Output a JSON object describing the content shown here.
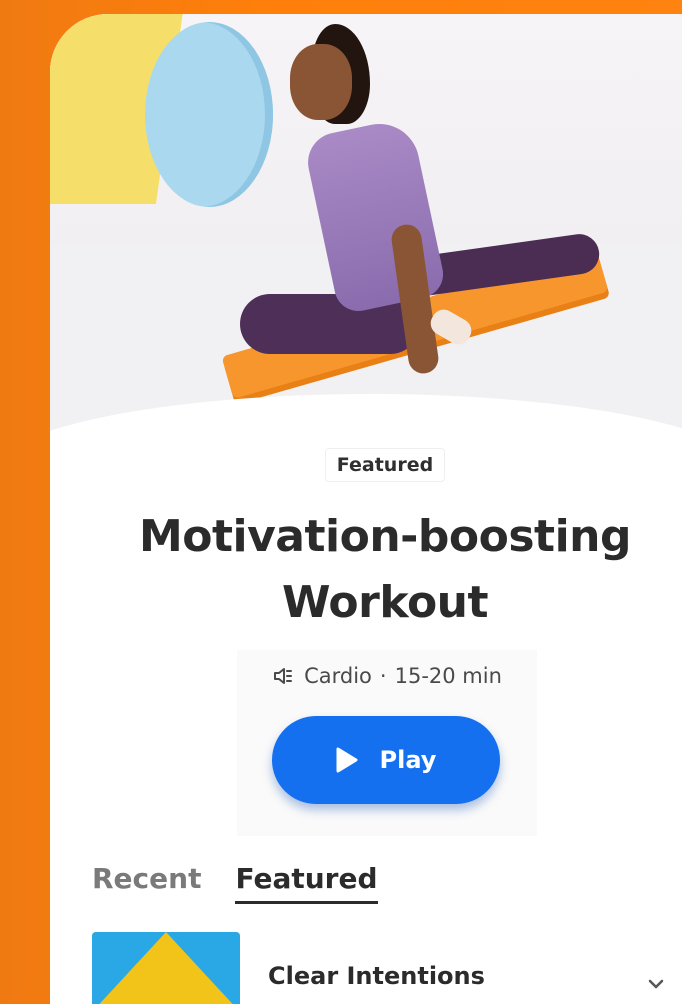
{
  "hero": {
    "image": "woman-stretching-on-yoga-mat"
  },
  "featured": {
    "tag": "Featured",
    "title": "Motivation-boosting Workout",
    "meta_icon": "speaker-icon",
    "category": "Cardio",
    "separator": "·",
    "duration": "15-20 min",
    "play_label": "Play",
    "play_icon": "play-icon",
    "accent": "#1570f0"
  },
  "tabs": [
    {
      "label": "Recent",
      "active": false
    },
    {
      "label": "Featured",
      "active": true
    }
  ],
  "list": [
    {
      "title": "Clear Intentions",
      "thumb_colors": [
        "#f2c318",
        "#2aa8e6"
      ]
    }
  ],
  "colors": {
    "background": "#ff7f0a",
    "card": "#ffffff",
    "text": "#2b2b2b"
  }
}
